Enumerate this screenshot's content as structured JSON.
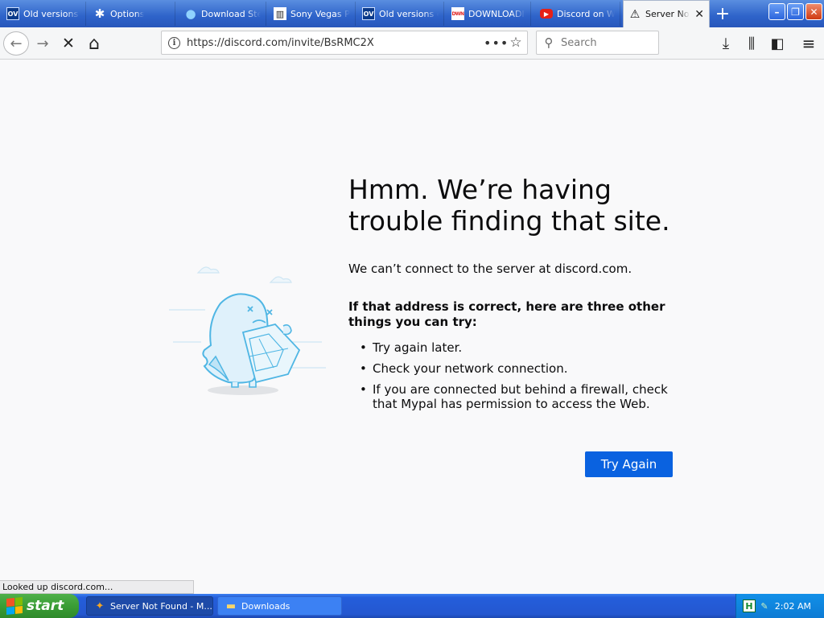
{
  "tabs": [
    {
      "label": "Old versions of",
      "icon": "ov-icon",
      "glyph": "OV"
    },
    {
      "label": "Options",
      "icon": "gear-icon",
      "glyph": "✱"
    },
    {
      "label": "Download Steam",
      "icon": "steam-icon",
      "glyph": "●"
    },
    {
      "label": "Sony Vegas Pro",
      "icon": "museum-icon",
      "glyph": "▥"
    },
    {
      "label": "Old versions of",
      "icon": "ov-icon",
      "glyph": "OV"
    },
    {
      "label": "DOWNLOADING",
      "icon": "downloading-site-icon",
      "glyph": "DWN"
    },
    {
      "label": "Discord on We",
      "icon": "youtube-icon",
      "glyph": "▶"
    },
    {
      "label": "Server Not Found",
      "icon": "warning-icon",
      "glyph": "⚠",
      "active": true
    }
  ],
  "window": {
    "new_tab": "+",
    "minimize": "–",
    "maximize": "❐",
    "close": "✕",
    "tab_close": "✕"
  },
  "nav": {
    "back": "←",
    "forward": "→",
    "stop": "✕",
    "home": "⌂",
    "url": "https://discord.com/invite/BsRMC2X",
    "info": "i",
    "page_actions": "•••",
    "bookmark": "☆",
    "search_placeholder": "Search",
    "search_glyph": "⚲",
    "downloads": "⤓",
    "library": "⫼",
    "sidebar": "◧",
    "menu": "≡"
  },
  "error": {
    "title": "Hmm. We’re having trouble finding that site.",
    "description": "We can’t connect to the server at discord.com.",
    "subtitle": "If that address is correct, here are three other things you can try:",
    "items": [
      "Try again later.",
      "Check your network connection.",
      "If you are connected but behind a firewall, check that Mypal has permission to access the Web."
    ],
    "button": "Try Again"
  },
  "status_text": "Looked up discord.com...",
  "taskbar": {
    "start": "start",
    "tasks": [
      {
        "label": "Server Not Found - M...",
        "icon": "mypal-icon",
        "glyph": "✦"
      },
      {
        "label": "Downloads",
        "icon": "folder-icon",
        "glyph": "▬"
      }
    ],
    "clock": "2:02 AM",
    "tray_icons": [
      "H",
      "✎"
    ]
  },
  "colors": {
    "accent": "#0a62e0",
    "taskbar": "#245edb",
    "start_green": "#3a9d35",
    "tab_strip": "#2e63c9",
    "illustration": "#4fb6e4"
  }
}
